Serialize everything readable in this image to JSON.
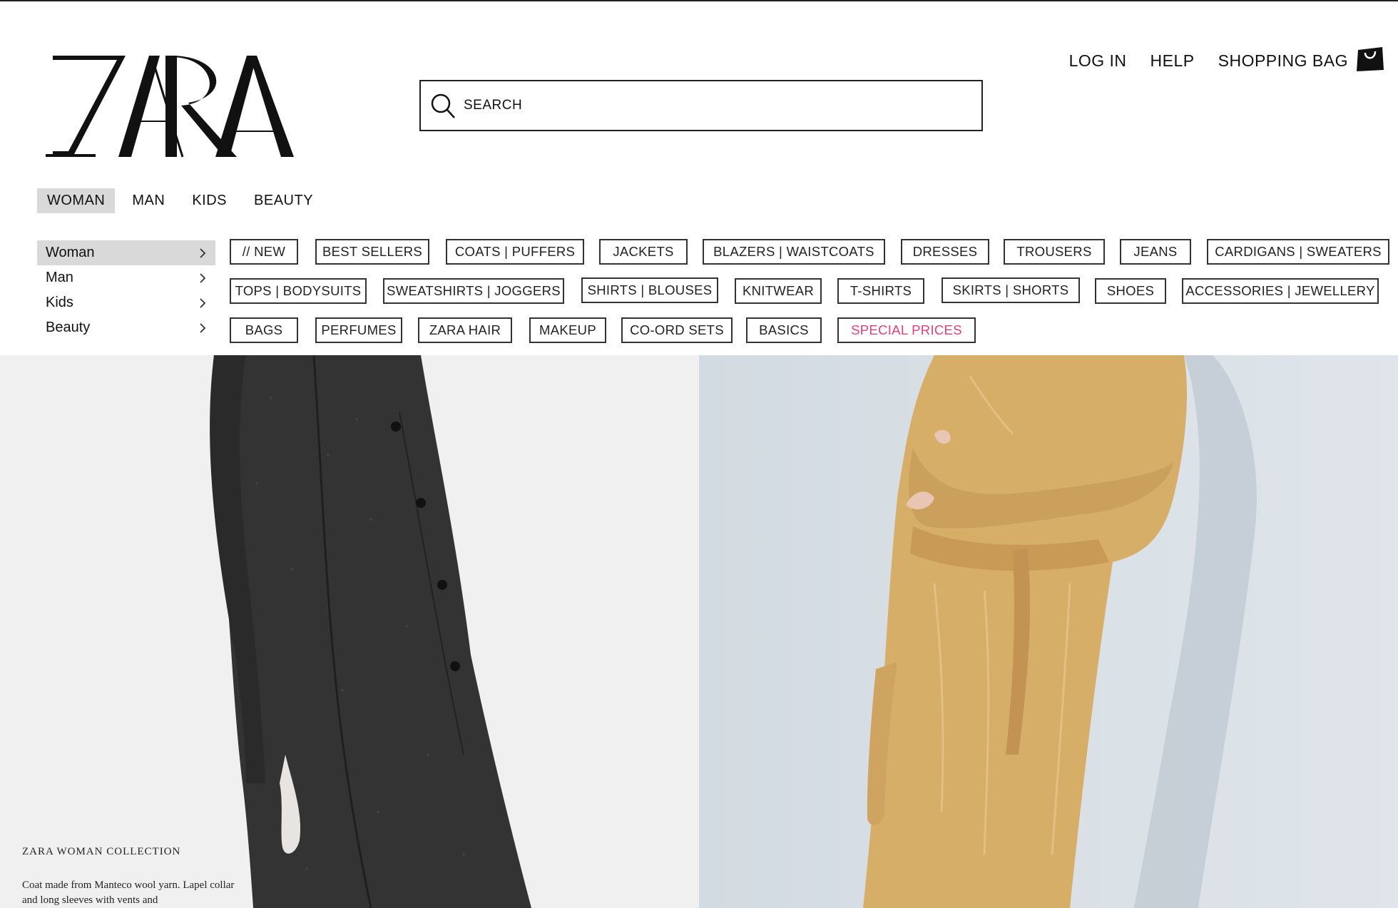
{
  "brand": {
    "name": "ZARA"
  },
  "search": {
    "placeholder": "SEARCH"
  },
  "header_links": {
    "login": "LOG IN",
    "help": "HELP",
    "bag": "SHOPPING BAG"
  },
  "gender_tabs": [
    "WOMAN",
    "MAN",
    "KIDS",
    "BEAUTY"
  ],
  "side_menu": [
    "Woman",
    "Man",
    "Kids",
    "Beauty"
  ],
  "categories": {
    "row1": [
      "// NEW",
      "BEST SELLERS",
      "COATS | PUFFERS",
      "JACKETS",
      "BLAZERS | WAISTCOATS",
      "DRESSES",
      "TROUSERS",
      "JEANS",
      "CARDIGANS | SWEATERS"
    ],
    "row2": [
      "TOPS | BODYSUITS",
      "SWEATSHIRTS | JOGGERS",
      "SHIRTS | BLOUSES",
      "KNITWEAR",
      "T-SHIRTS",
      "SKIRTS | SHORTS",
      "SHOES",
      "ACCESSORIES | JEWELLERY"
    ],
    "row3": [
      "BAGS",
      "PERFUMES",
      "ZARA HAIR",
      "MAKEUP",
      "CO-ORD SETS",
      "BASICS",
      "SPECIAL PRICES"
    ]
  },
  "hero": {
    "caption_title": "ZARA WOMAN COLLECTION",
    "caption_text": "Coat made from Manteco wool yarn. Lapel collar and long sleeves with vents and"
  },
  "colors": {
    "special_prices": "#e0417a",
    "active_tab_bg": "#d9d9d9"
  },
  "icons": {
    "search": "search-icon",
    "bag": "shopping-bag-icon",
    "chevron": "chevron-right-icon"
  }
}
